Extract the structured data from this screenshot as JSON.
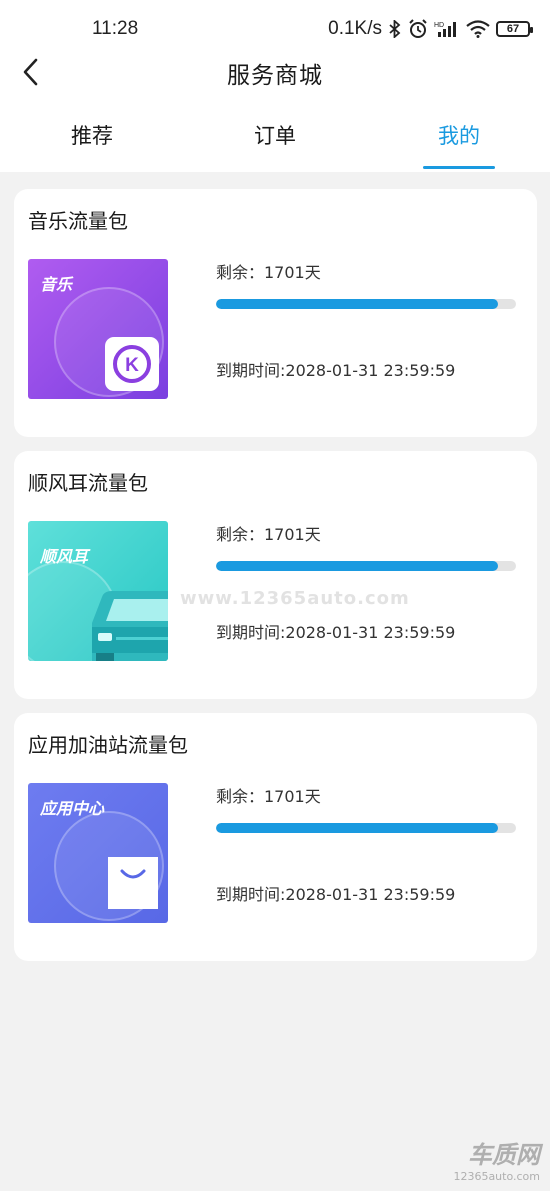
{
  "status_bar": {
    "time": "11:28",
    "net_speed": "0.1K/s",
    "battery": "67",
    "icons": [
      "bluetooth-icon",
      "alarm-icon",
      "hd-signal-icon",
      "wifi-icon",
      "battery-icon"
    ]
  },
  "header": {
    "title": "服务商城",
    "back_icon": "chevron-left-icon"
  },
  "tabs": [
    {
      "label": "推荐",
      "active": false
    },
    {
      "label": "订单",
      "active": false
    },
    {
      "label": "我的",
      "active": true
    }
  ],
  "accent_color": "#1a9ae0",
  "packages": [
    {
      "title": "音乐流量包",
      "thumb_label": "音乐",
      "thumb_icon": "k-music-app-icon",
      "remaining": "剩余：1701天",
      "progress": 0.94,
      "expiry": "到期时间:2028-01-31 23:59:59"
    },
    {
      "title": "顺风耳流量包",
      "thumb_label": "顺风耳",
      "thumb_icon": "car-icon",
      "remaining": "剩余：1701天",
      "progress": 0.94,
      "expiry": "到期时间:2028-01-31 23:59:59"
    },
    {
      "title": "应用加油站流量包",
      "thumb_label": "应用中心",
      "thumb_icon": "shopping-bag-icon",
      "remaining": "剩余：1701天",
      "progress": 0.94,
      "expiry": "到期时间:2028-01-31 23:59:59"
    }
  ],
  "watermark": "www.12365auto.com",
  "corner_logo": {
    "name": "车质网",
    "url": "12365auto.com"
  }
}
